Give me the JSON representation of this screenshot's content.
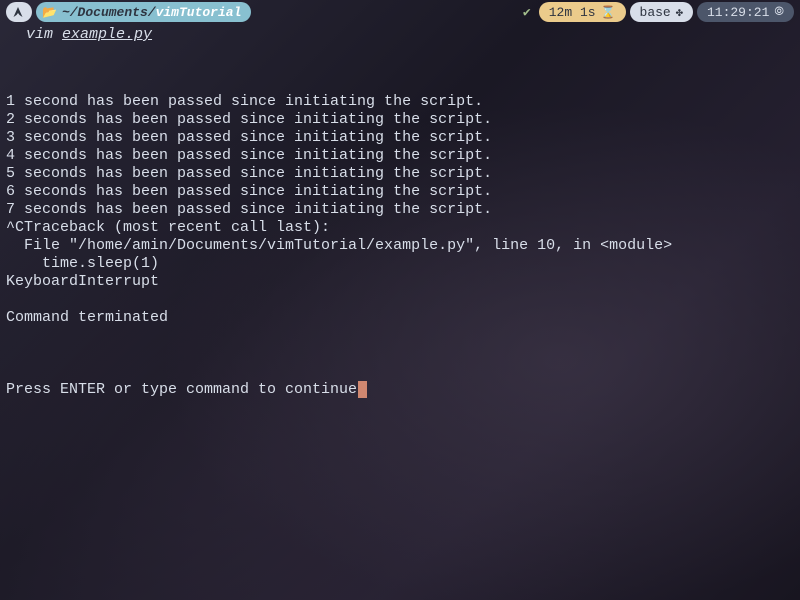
{
  "statusbar": {
    "path_prefix": "~/Documents/",
    "path_highlight": "vimTutorial",
    "timer": "12m 1s",
    "env": "base",
    "clock": "11:29:21"
  },
  "title": {
    "command": "vim",
    "filename": "example.py"
  },
  "output": {
    "lines": [
      "1 second has been passed since initiating the script.",
      "2 seconds has been passed since initiating the script.",
      "3 seconds has been passed since initiating the script.",
      "4 seconds has been passed since initiating the script.",
      "5 seconds has been passed since initiating the script.",
      "6 seconds has been passed since initiating the script.",
      "7 seconds has been passed since initiating the script.",
      "^CTraceback (most recent call last):",
      "  File \"/home/amin/Documents/vimTutorial/example.py\", line 10, in <module>",
      "    time.sleep(1)",
      "KeyboardInterrupt",
      "",
      "Command terminated",
      ""
    ],
    "prompt": "Press ENTER or type command to continue"
  }
}
